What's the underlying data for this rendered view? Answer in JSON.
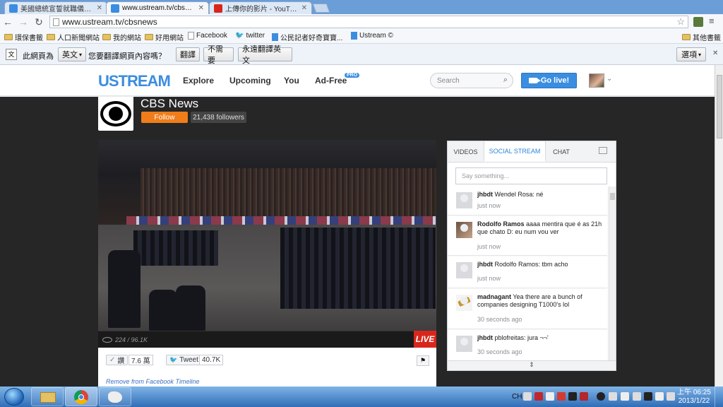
{
  "browser": {
    "tabs": [
      {
        "title": "美國總統宣誓就職儀式直播",
        "color": "#3b8de0"
      },
      {
        "title": "www.ustream.tv/cbsnew",
        "color": "#3b8de0"
      },
      {
        "title": "上傳你的影片 - YouTube",
        "color": "#d9261c"
      }
    ],
    "address": "www.ustream.tv/cbsnews",
    "bookmarks": [
      "環保書籤",
      "人口新聞網站",
      "我的網站",
      "好用網站",
      "Facebook",
      "twitter",
      "公民記者好奇寶寶...",
      "Ustream ©"
    ],
    "other_bookmarks": "其他書籤"
  },
  "translate_bar": {
    "prefix": "此網頁為",
    "language": "英文",
    "question": "您要翻譯網頁內容嗎？",
    "translate_btn": "翻譯",
    "no_btn": "不需要",
    "always_btn": "永遠翻譯英文",
    "options_btn": "選項"
  },
  "site_header": {
    "logo": "USTREAM",
    "nav": [
      "Explore",
      "Upcoming",
      "You",
      "Ad-Free"
    ],
    "pro_badge": "PRO",
    "search_placeholder": "Search",
    "golive": "Go live!"
  },
  "channel": {
    "name": "CBS News",
    "follow": "Follow",
    "followers": "21,438 followers"
  },
  "video": {
    "viewers": "224 / 96.1K",
    "live_badge": "LIVE"
  },
  "share": {
    "like_label": "讚",
    "like_count": "7.6 萬",
    "tweet_label": "Tweet",
    "tweet_count": "40.7K",
    "remove_link": "Remove from Facebook Timeline"
  },
  "panel": {
    "tabs": [
      "VIDEOS",
      "SOCIAL STREAM",
      "CHAT"
    ],
    "active_tab": "SOCIAL STREAM",
    "say_placeholder": "Say something...",
    "posts": [
      {
        "user": "jhbdt",
        "text": "Wendel Rosa: né",
        "time": "just now"
      },
      {
        "user": "Rodolfo Ramos",
        "text": "aaaa mentira que é as 21h que chato D: eu num vou ver",
        "time": "just now"
      },
      {
        "user": "jhbdt",
        "text": "Rodolfo Ramos: tbm acho",
        "time": "just now"
      },
      {
        "user": "madnagant",
        "text": "Yea there are a bunch of companies designing T1000's lol",
        "time": "30 seconds ago"
      },
      {
        "user": "jhbdt",
        "text": "pblofreitas: jura ¬¬'",
        "time": "30 seconds ago"
      }
    ]
  },
  "taskbar": {
    "ime": "CH",
    "time": "上午 06:25",
    "date": "2013/1/22"
  }
}
